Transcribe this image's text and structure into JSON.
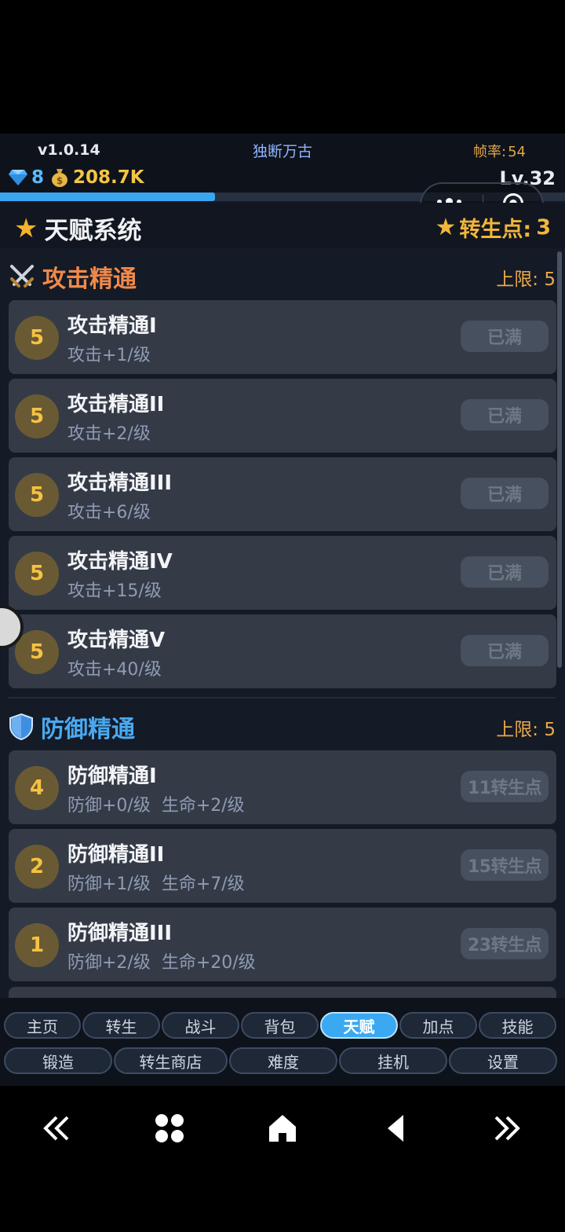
{
  "header": {
    "version": "v1.0.14",
    "game_title": "独断万古",
    "fps_label": "帧率:",
    "fps_value": "54",
    "gems": "8",
    "gold": "208.7K",
    "level": "Lv.32",
    "exp_progress": 0.38
  },
  "talent_system": {
    "title": "天赋系统",
    "points_label": "转生点:",
    "points_value": "3"
  },
  "sections": [
    {
      "title": "攻击精通",
      "limit": "上限: 5",
      "color": "#f0894a",
      "items": [
        {
          "level": "5",
          "name": "攻击精通I",
          "desc": "攻击+1/级",
          "action": "已满"
        },
        {
          "level": "5",
          "name": "攻击精通II",
          "desc": "攻击+2/级",
          "action": "已满"
        },
        {
          "level": "5",
          "name": "攻击精通III",
          "desc": "攻击+6/级",
          "action": "已满"
        },
        {
          "level": "5",
          "name": "攻击精通IV",
          "desc": "攻击+15/级",
          "action": "已满"
        },
        {
          "level": "5",
          "name": "攻击精通V",
          "desc": "攻击+40/级",
          "action": "已满"
        }
      ]
    },
    {
      "title": "防御精通",
      "limit": "上限: 5",
      "color": "#49a9f0",
      "items": [
        {
          "level": "4",
          "name": "防御精通I",
          "desc": "防御+0/级  生命+2/级",
          "action": "11转生点"
        },
        {
          "level": "2",
          "name": "防御精通II",
          "desc": "防御+1/级  生命+7/级",
          "action": "15转生点"
        },
        {
          "level": "1",
          "name": "防御精通III",
          "desc": "防御+2/级  生命+20/级",
          "action": "23转生点"
        }
      ]
    }
  ],
  "nav": {
    "row1": [
      "主页",
      "转生",
      "战斗",
      "背包",
      "天赋",
      "加点",
      "技能"
    ],
    "row2": [
      "锻造",
      "转生商店",
      "难度",
      "挂机",
      "设置"
    ],
    "active": "天赋"
  },
  "icons": {
    "gem": "diamond-icon",
    "gold": "money-bag-icon",
    "star": "star-icon",
    "attack": "crossed-swords-icon",
    "defense": "shield-icon"
  }
}
